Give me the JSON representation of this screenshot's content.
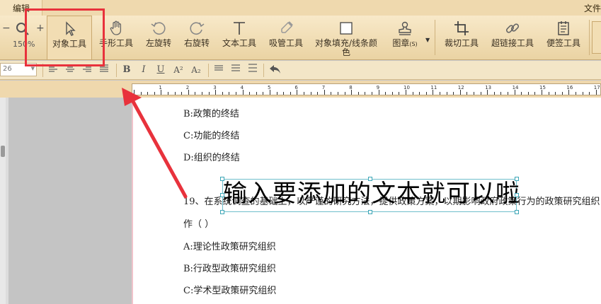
{
  "tabs": {
    "edit": "编辑",
    "file": "文件"
  },
  "zoom": {
    "value": "150%"
  },
  "toolbar": [
    {
      "label": "对象工具",
      "icon": "pointer-cursor-icon",
      "selected": true
    },
    {
      "label": "手形工具",
      "icon": "hand-icon"
    },
    {
      "label": "左旋转",
      "icon": "rotate-left-icon"
    },
    {
      "label": "右旋转",
      "icon": "rotate-right-icon"
    },
    {
      "label": "文本工具",
      "icon": "text-tool-icon"
    },
    {
      "label": "吸管工具",
      "icon": "eyedropper-icon"
    },
    {
      "label": "对象填充/线条颜色",
      "icon": "fill-color-icon"
    },
    {
      "label": "图章",
      "sub": "(S)",
      "icon": "stamp-icon"
    },
    {
      "label": "裁切工具",
      "icon": "crop-icon"
    },
    {
      "label": "超链接工具",
      "icon": "link-icon"
    },
    {
      "label": "便签工具",
      "icon": "note-icon"
    }
  ],
  "format": {
    "font_size": "26",
    "bold": "B",
    "italic": "I",
    "underline": "U",
    "superscript": "A²",
    "subscript": "A₂"
  },
  "ruler": {
    "numbers": [
      "1",
      "2",
      "3",
      "4",
      "5",
      "6",
      "7",
      "8",
      "9",
      "10",
      "11",
      "12",
      "13",
      "14",
      "15",
      "16",
      "17"
    ]
  },
  "document": {
    "lines": [
      "B:政策的终结",
      "C:功能的终结",
      "D:组织的终结",
      "19、在系统调查的基础上，以严谨的研究方法，提供政策方案，以期影响政府政策行为的政策研究组织",
      "作（ ）",
      "A:理论性政策研究组织",
      "B:行政型政策研究组织",
      "C:学术型政策研究组织"
    ],
    "textbox_text": "输入要添加的文本就可以啦"
  },
  "colors": {
    "annotation_red": "#e8323c",
    "handle_teal": "#3ba5b6"
  }
}
